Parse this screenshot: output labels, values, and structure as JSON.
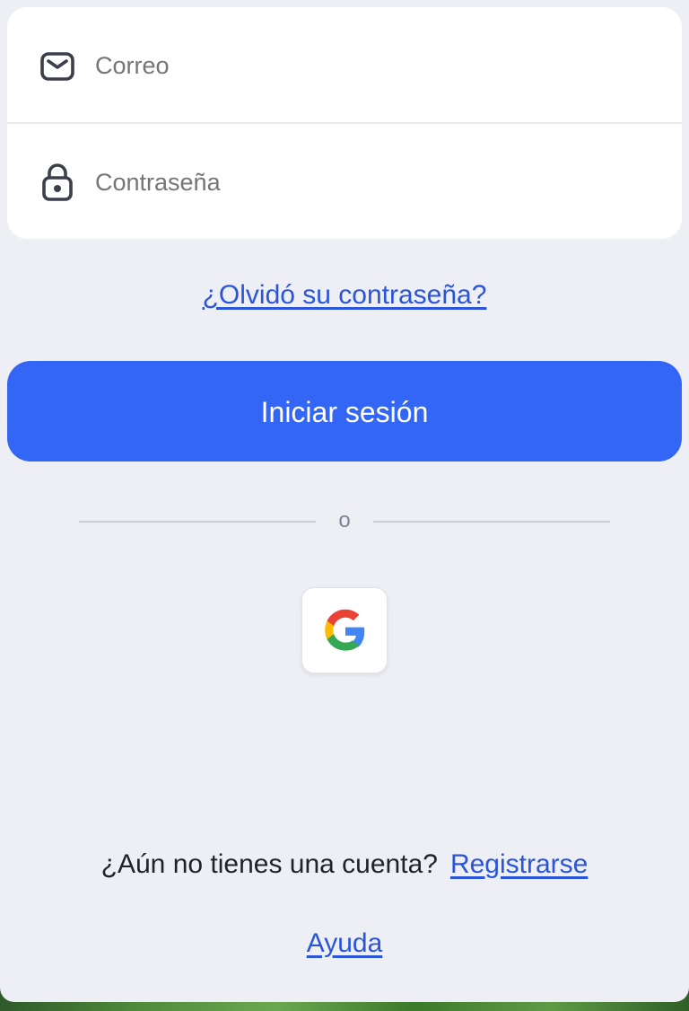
{
  "form": {
    "email_placeholder": "Correo",
    "password_placeholder": "Contraseña"
  },
  "links": {
    "forgot_password": "¿Olvidó su contraseña?",
    "register_prompt": "¿Aún no tienes una cuenta?",
    "register": "Registrarse",
    "help": "Ayuda"
  },
  "buttons": {
    "login": "Iniciar sesión"
  },
  "divider": {
    "label": "o"
  },
  "icons": {
    "email": "mail-icon",
    "password": "lock-icon",
    "google": "google-icon"
  },
  "colors": {
    "primary": "#3366f5",
    "link": "#2b55d9",
    "panel_background": "#edeff4"
  }
}
